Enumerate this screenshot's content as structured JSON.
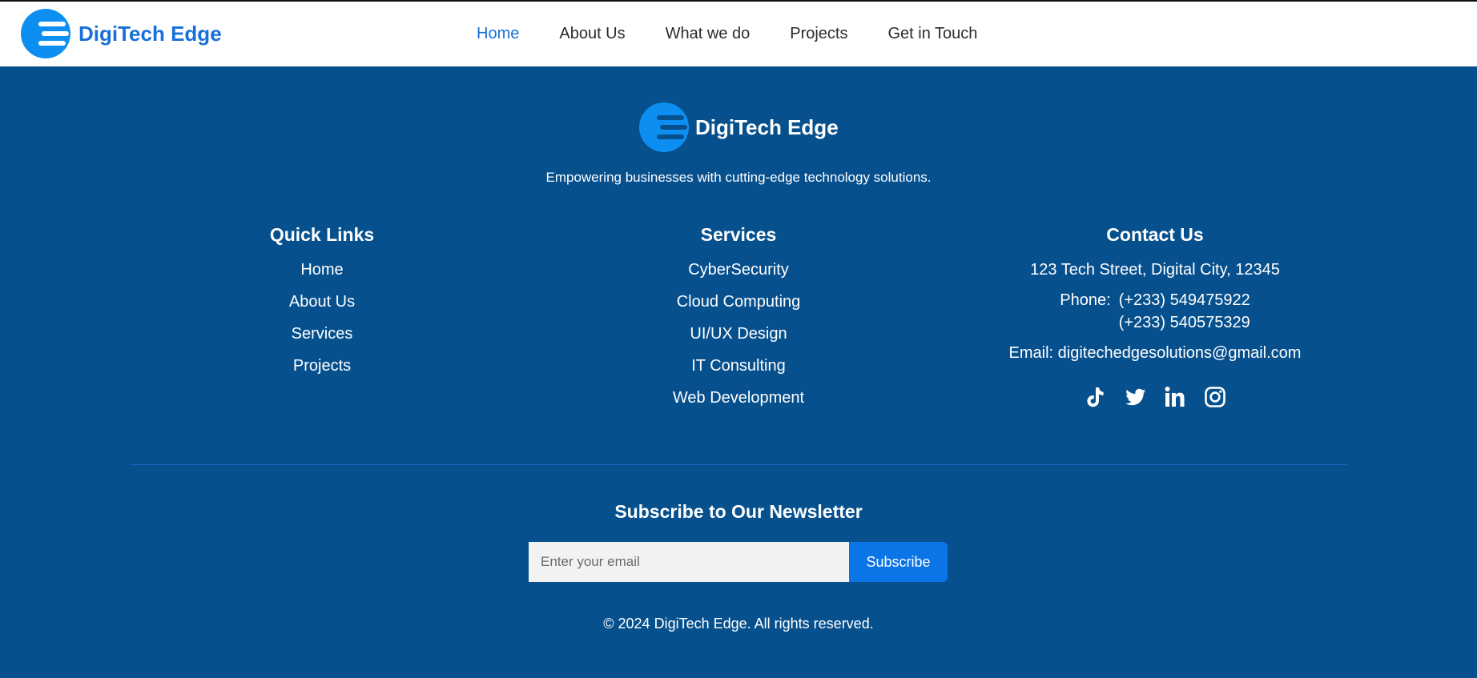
{
  "brand": {
    "name": "DigiTech Edge",
    "accent_color": "#1670d9",
    "logo_color": "#0d8ff2"
  },
  "nav": {
    "items": [
      {
        "label": "Home",
        "active": true
      },
      {
        "label": "About Us",
        "active": false
      },
      {
        "label": "What we do",
        "active": false
      },
      {
        "label": "Projects",
        "active": false
      },
      {
        "label": "Get in Touch",
        "active": false
      }
    ]
  },
  "footer": {
    "background": "#07508e",
    "brand_name": "DigiTech Edge",
    "tagline": "Empowering businesses with cutting-edge technology solutions.",
    "quick_links": {
      "title": "Quick Links",
      "items": [
        "Home",
        "About Us",
        "Services",
        "Projects"
      ]
    },
    "services": {
      "title": "Services",
      "items": [
        "CyberSecurity",
        "Cloud Computing",
        "UI/UX Design",
        "IT Consulting",
        "Web Development"
      ]
    },
    "contact": {
      "title": "Contact Us",
      "address": "123 Tech Street, Digital City, 12345",
      "phone_label": "Phone:",
      "phones": [
        "(+233) 549475922",
        "(+233) 540575329"
      ],
      "email": "Email: digitechedgesolutions@gmail.com",
      "socials": [
        "tiktok-icon",
        "twitter-icon",
        "linkedin-icon",
        "instagram-icon"
      ]
    },
    "newsletter": {
      "title": "Subscribe to Our Newsletter",
      "placeholder": "Enter your email",
      "value": "",
      "button_label": "Subscribe",
      "button_color": "#0b74e6"
    },
    "copyright": "© 2024 DigiTech Edge. All rights reserved."
  }
}
